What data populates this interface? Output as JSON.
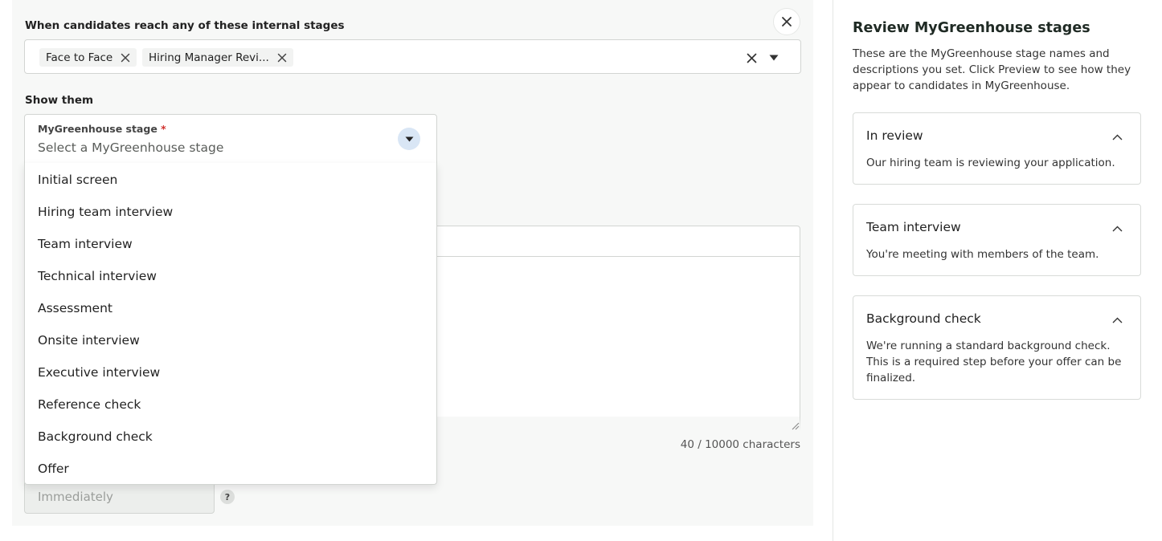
{
  "form": {
    "stages_label": "When candidates reach any of these internal stages",
    "selected_stages": [
      "Face to Face",
      "Hiring Manager Revi..."
    ],
    "show_label": "Show them",
    "stage_select": {
      "label": "MyGreenhouse stage",
      "required_mark": "*",
      "placeholder": "Select a MyGreenhouse stage"
    },
    "options": [
      "Initial screen",
      "Hiring team interview",
      "Team interview",
      "Technical interview",
      "Assessment",
      "Onsite interview",
      "Executive interview",
      "Reference check",
      "Background check",
      "Offer"
    ],
    "char_count": "40 / 10000 characters",
    "timing_value": "Immediately",
    "help_mark": "?"
  },
  "review": {
    "title": "Review MyGreenhouse stages",
    "description": "These are the MyGreenhouse stage names and descriptions you set. Click Preview to see how they appear to candidates in MyGreenhouse.",
    "cards": [
      {
        "title": "In review",
        "description": "Our hiring team is reviewing your application."
      },
      {
        "title": "Team interview",
        "description": "You're meeting with members of the team."
      },
      {
        "title": "Background check",
        "description": "We're running a standard background check. This is a required step before your offer can be finalized."
      }
    ]
  },
  "icons": {
    "close": "close-icon",
    "chip_remove": "x-icon",
    "clear": "clear-icon",
    "caret": "caret-down-icon",
    "chevron": "chevron-up-icon",
    "resize": "resize-grip-icon"
  },
  "colors": {
    "required": "#d0312d",
    "caret_bg": "#d9e6f5",
    "panel_bg": "#f7f8f7"
  }
}
